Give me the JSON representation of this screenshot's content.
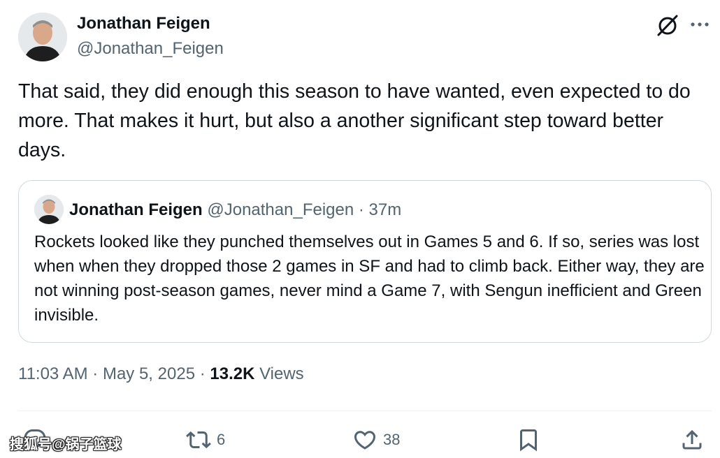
{
  "author": {
    "name": "Jonathan Feigen",
    "handle": "@Jonathan_Feigen"
  },
  "tweet": {
    "text": "That said, they did enough this season to have wanted, even expected to do more. That makes it hurt, but also a another significant step toward better days."
  },
  "quoted_tweet": {
    "name": "Jonathan Feigen",
    "handle": "@Jonathan_Feigen",
    "separator": " · ",
    "time": "37m",
    "text": "Rockets looked like they punched themselves out in Games 5 and 6. If so, series was lost when when they dropped those 2 games in SF and had to climb back. Either way, they are not winning post-season games, never mind a Game 7, with Sengun inefficient and Green invisible."
  },
  "meta": {
    "time": "11:03 AM",
    "date": "May 5, 2025",
    "views_count": "13.2K",
    "views_label": "Views",
    "separator": " · "
  },
  "actions": {
    "reposts": "6",
    "likes": "38"
  },
  "watermark": "搜狐号@锅子篮球",
  "icons": [
    "grok-icon",
    "more-icon",
    "reply-icon",
    "repost-icon",
    "like-icon",
    "bookmark-icon",
    "share-icon"
  ],
  "colors": {
    "text_primary": "#0f1419",
    "text_secondary": "#536471",
    "border": "#cfd9de"
  }
}
